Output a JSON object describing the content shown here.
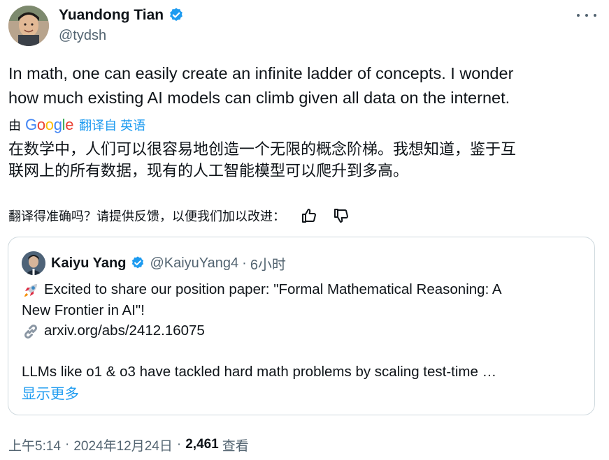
{
  "author": {
    "name": "Yuandong Tian",
    "handle": "@tydsh",
    "verified_color": "#1d9bf0"
  },
  "tweet": {
    "text_line1": "In math, one can easily create an infinite ladder of concepts. I wonder",
    "text_line2": "how much existing AI models can climb given all data on the internet."
  },
  "translation": {
    "by_label": "由",
    "provider": "Google",
    "translated_from": "翻译自 英语",
    "text_line1": "在数学中，人们可以很容易地创造一个无限的概念阶梯。我想知道，鉴于互",
    "text_line2": "联网上的所有数据，现有的人工智能模型可以爬升到多高。",
    "feedback_prompt": "翻译得准确吗？请提供反馈，以便我们加以改进：",
    "thumbs_up_icon": "thumbs-up-icon",
    "thumbs_down_icon": "thumbs-down-icon"
  },
  "quote": {
    "name": "Kaiyu Yang",
    "handle": "@KaiyuYang4",
    "separator": "·",
    "time": "6小时",
    "line1": "Excited to share our position paper: \"Formal Mathematical Reasoning: A",
    "line2": "New Frontier in AI\"!",
    "link": "arxiv.org/abs/2412.16075",
    "line4": "LLMs like o1 & o3 have tackled hard math problems by scaling test-time …",
    "show_more": "显示更多",
    "rocket_icon": "rocket-icon",
    "link_icon": "link-icon"
  },
  "meta": {
    "time": "上午5:14",
    "date": "2024年12月24日",
    "separator": "·",
    "views_count": "2,461",
    "views_label": "查看"
  }
}
